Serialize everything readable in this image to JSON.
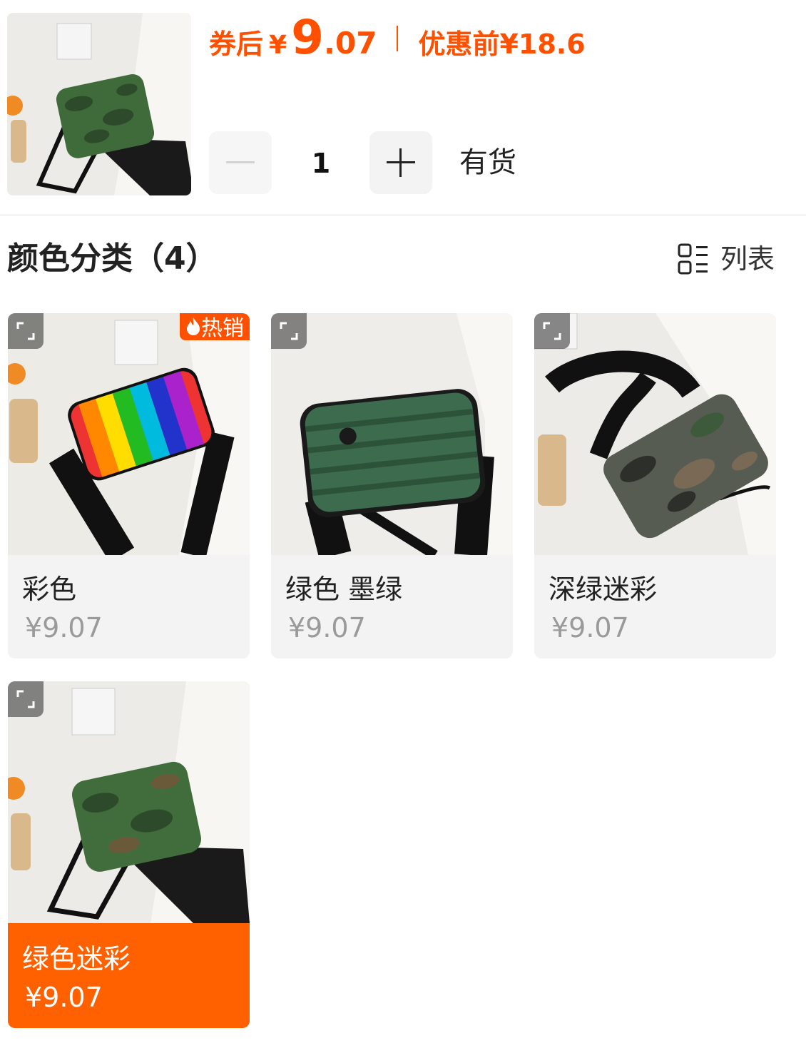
{
  "header": {
    "price_label": "券后",
    "currency": "¥",
    "price_int": "9",
    "price_dec": ".07",
    "before_label": "优惠前",
    "before_price": "¥18.6",
    "quantity": "1",
    "stock_status": "有货",
    "minus_icon": "minus-icon",
    "plus_icon": "plus-icon"
  },
  "section": {
    "title": "颜色分类（4）",
    "view_label": "列表",
    "view_icon": "list-view-icon"
  },
  "variants": [
    {
      "name": "彩色",
      "price": "¥9.07",
      "badge": "热销",
      "badge_icon": "flame-icon"
    },
    {
      "name": "绿色 墨绿",
      "price": "¥9.07"
    },
    {
      "name": "深绿迷彩",
      "price": "¥9.07"
    },
    {
      "name": "绿色迷彩",
      "price": "¥9.07",
      "selected": true
    }
  ],
  "colors": {
    "accent": "#ff5000",
    "selected_bg": "#ff6000"
  }
}
